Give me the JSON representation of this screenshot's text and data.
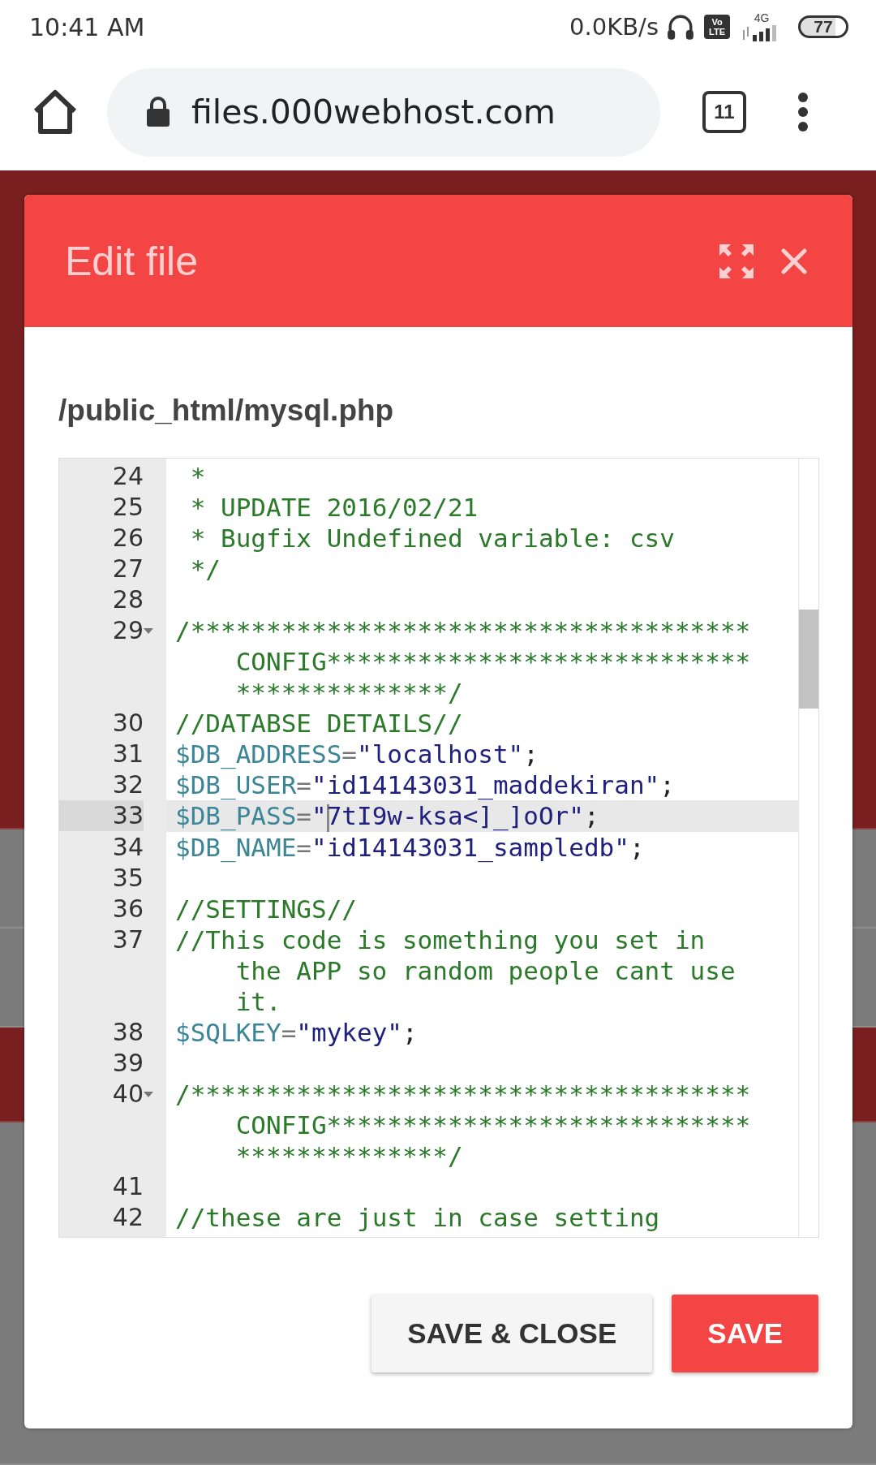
{
  "status_bar": {
    "time": "10:41 AM",
    "speed": "0.0KB/s",
    "volte": [
      "Vo",
      "LTE"
    ],
    "network": "4G",
    "battery": "77"
  },
  "browser": {
    "url": "files.000webhost.com",
    "tab_count": "11"
  },
  "dialog": {
    "title": "Edit file",
    "path": "/public_html/mysql.php",
    "editor": {
      "lines": [
        {
          "number": "24",
          "foldable": false,
          "active": false,
          "tokens": [
            {
              "kind": "comment",
              "text": " *"
            }
          ]
        },
        {
          "number": "25",
          "foldable": false,
          "active": false,
          "tokens": [
            {
              "kind": "comment",
              "text": " * UPDATE 2016/02/21"
            }
          ]
        },
        {
          "number": "26",
          "foldable": false,
          "active": false,
          "tokens": [
            {
              "kind": "comment",
              "text": " * Bugfix Undefined variable: csv"
            }
          ]
        },
        {
          "number": "27",
          "foldable": false,
          "active": false,
          "tokens": [
            {
              "kind": "comment",
              "text": " */"
            }
          ]
        },
        {
          "number": "28",
          "foldable": false,
          "active": false
        },
        {
          "number": "29",
          "foldable": true,
          "active": false,
          "tokens": [
            {
              "kind": "comment",
              "text": "/************************************* CONFIG******************************************/"
            }
          ]
        },
        {
          "number": "30",
          "foldable": false,
          "active": false,
          "tokens": [
            {
              "kind": "comment",
              "text": "//DATABSE DETAILS//"
            }
          ]
        },
        {
          "number": "31",
          "foldable": false,
          "active": false,
          "tokens": [
            {
              "kind": "variable",
              "text": "$DB_ADDRESS"
            },
            {
              "kind": "operator",
              "text": "="
            },
            {
              "kind": "string",
              "text": "\"localhost\""
            },
            {
              "kind": "punct",
              "text": ";"
            }
          ]
        },
        {
          "number": "32",
          "foldable": false,
          "active": false,
          "tokens": [
            {
              "kind": "variable",
              "text": "$DB_USER"
            },
            {
              "kind": "operator",
              "text": "="
            },
            {
              "kind": "string",
              "text": "\"id14143031_maddekiran\""
            },
            {
              "kind": "punct",
              "text": ";"
            }
          ]
        },
        {
          "number": "33",
          "foldable": false,
          "active": true,
          "tokens": [
            {
              "kind": "variable",
              "text": "$DB_PASS"
            },
            {
              "kind": "operator",
              "text": "="
            },
            {
              "kind": "string",
              "text": "\""
            },
            {
              "kind": "string",
              "text": "7tI9w-ksa<]_]oOr\"",
              "cursor": true
            },
            {
              "kind": "punct",
              "text": ";"
            }
          ]
        },
        {
          "number": "34",
          "foldable": false,
          "active": false,
          "tokens": [
            {
              "kind": "variable",
              "text": "$DB_NAME"
            },
            {
              "kind": "operator",
              "text": "="
            },
            {
              "kind": "string",
              "text": "\"id14143031_sampledb\""
            },
            {
              "kind": "punct",
              "text": ";"
            }
          ]
        },
        {
          "number": "35",
          "foldable": false,
          "active": false
        },
        {
          "number": "36",
          "foldable": false,
          "active": false,
          "tokens": [
            {
              "kind": "comment",
              "text": "//SETTINGS//"
            }
          ]
        },
        {
          "number": "37",
          "foldable": false,
          "active": false,
          "tokens": [
            {
              "kind": "comment",
              "text": "//This code is something you set in the APP so random people cant use it."
            }
          ]
        },
        {
          "number": "38",
          "foldable": false,
          "active": false,
          "tokens": [
            {
              "kind": "variable",
              "text": "$SQLKEY"
            },
            {
              "kind": "operator",
              "text": "="
            },
            {
              "kind": "string",
              "text": "\"mykey\""
            },
            {
              "kind": "punct",
              "text": ";"
            }
          ]
        },
        {
          "number": "39",
          "foldable": false,
          "active": false
        },
        {
          "number": "40",
          "foldable": true,
          "active": false,
          "tokens": [
            {
              "kind": "comment",
              "text": "/************************************* CONFIG******************************************/"
            }
          ]
        },
        {
          "number": "41",
          "foldable": false,
          "active": false
        },
        {
          "number": "42",
          "foldable": false,
          "active": false,
          "tokens": [
            {
              "kind": "comment",
              "text": "//these are just in case setting"
            }
          ]
        }
      ]
    },
    "buttons": [
      {
        "label": "SAVE & CLOSE",
        "kind": "secondary"
      },
      {
        "label": "SAVE",
        "kind": "primary"
      }
    ]
  }
}
